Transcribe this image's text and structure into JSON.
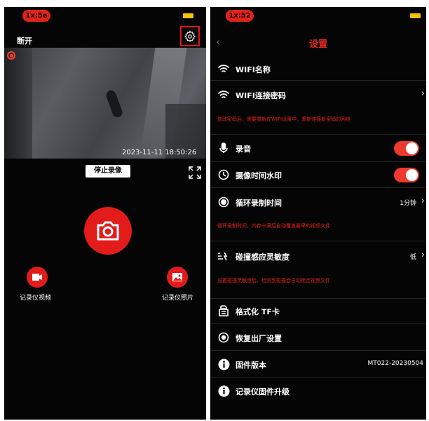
{
  "left": {
    "status_time": "1x:5e",
    "disconnect_label": "断开",
    "timestamp": "2023-11-11 18:50:26",
    "stop_recording_label": "停止录像",
    "dvr_video_label": "记录仪视频",
    "dvr_photo_label": "记录仪照片"
  },
  "right": {
    "status_time": "1x:52",
    "back_symbol": "‹",
    "title": "设置",
    "items": [
      {
        "label": "WIFI名称",
        "icon": "wifi-icon"
      },
      {
        "label": "WIFI连接密码",
        "icon": "wifi-icon"
      },
      {
        "label": "录音",
        "icon": "microphone-icon",
        "toggle": true
      },
      {
        "label": "摄像时间水印",
        "icon": "clock-icon",
        "toggle": true
      },
      {
        "label": "循环录制时间",
        "icon": "record-icon",
        "value": "1分钟"
      },
      {
        "label": "碰撞感应灵敏度",
        "icon": "collision-icon",
        "value": "低"
      },
      {
        "label": "格式化 TF卡",
        "icon": "sdcard-icon"
      },
      {
        "label": "恢复出厂设置",
        "icon": "reset-icon"
      },
      {
        "label": "固件版本",
        "icon": "info-icon",
        "value": "MT022-20230504"
      },
      {
        "label": "记录仪固件升级",
        "icon": "info-icon"
      }
    ],
    "notes": {
      "wifi": "修改密码后，需要重新在WIFI设置中，重新连接新密码的网络",
      "loop": "循环录制时间，内存卡满后自动覆盖最早的视频文件",
      "collision": "设置碰撞灵敏度后，检测到碰撞会自动锁定视频文件"
    }
  },
  "colors": {
    "accent": "#e2231a",
    "toggle_on": "#ee3a2c",
    "battery": "#f6c100",
    "background": "#050505"
  }
}
